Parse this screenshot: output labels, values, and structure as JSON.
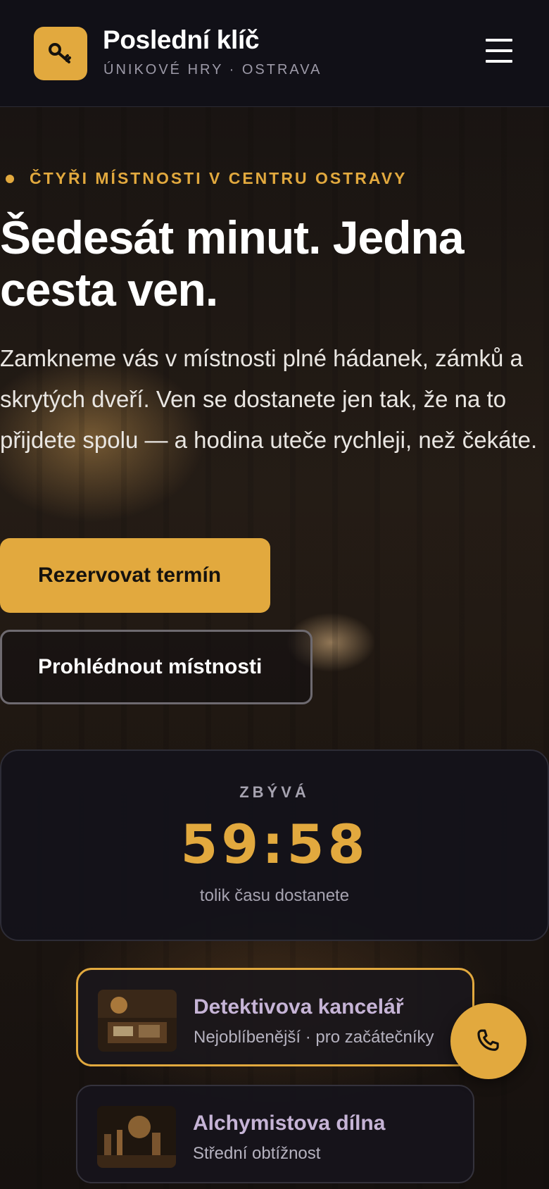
{
  "header": {
    "brand_name": "Poslední klíč",
    "brand_subtitle": "ÚNIKOVÉ HRY · OSTRAVA",
    "logo_icon": "key-icon",
    "menu_icon": "hamburger-menu-icon"
  },
  "hero": {
    "eyebrow": "ČTYŘI MÍSTNOSTI V CENTRU OSTRAVY",
    "headline": "Šedesát minut. Jedna cesta ven.",
    "intro": "Zamkneme vás v místnosti plné hádanek, zámků a skrytých dveří. Ven se dostanete jen tak, že na to přijdete spolu — a hodina uteče rychleji, než čekáte.",
    "primary_cta": "Rezervovat termín",
    "secondary_cta": "Prohlédnout místnosti"
  },
  "timer": {
    "label": "ZBÝVÁ",
    "value": "59:58",
    "caption": "tolik času dostanete"
  },
  "rooms": [
    {
      "title": "Detektivova kancelář",
      "subtitle": "Nejoblíbenější · pro začátečníky",
      "active": true
    },
    {
      "title": "Alchymistova dílna",
      "subtitle": "Střední obtížnost",
      "active": false
    }
  ],
  "fab": {
    "icon": "phone-icon"
  },
  "colors": {
    "accent": "#e2a93e",
    "header_bg": "#111017",
    "card_bg": "#13121a"
  }
}
